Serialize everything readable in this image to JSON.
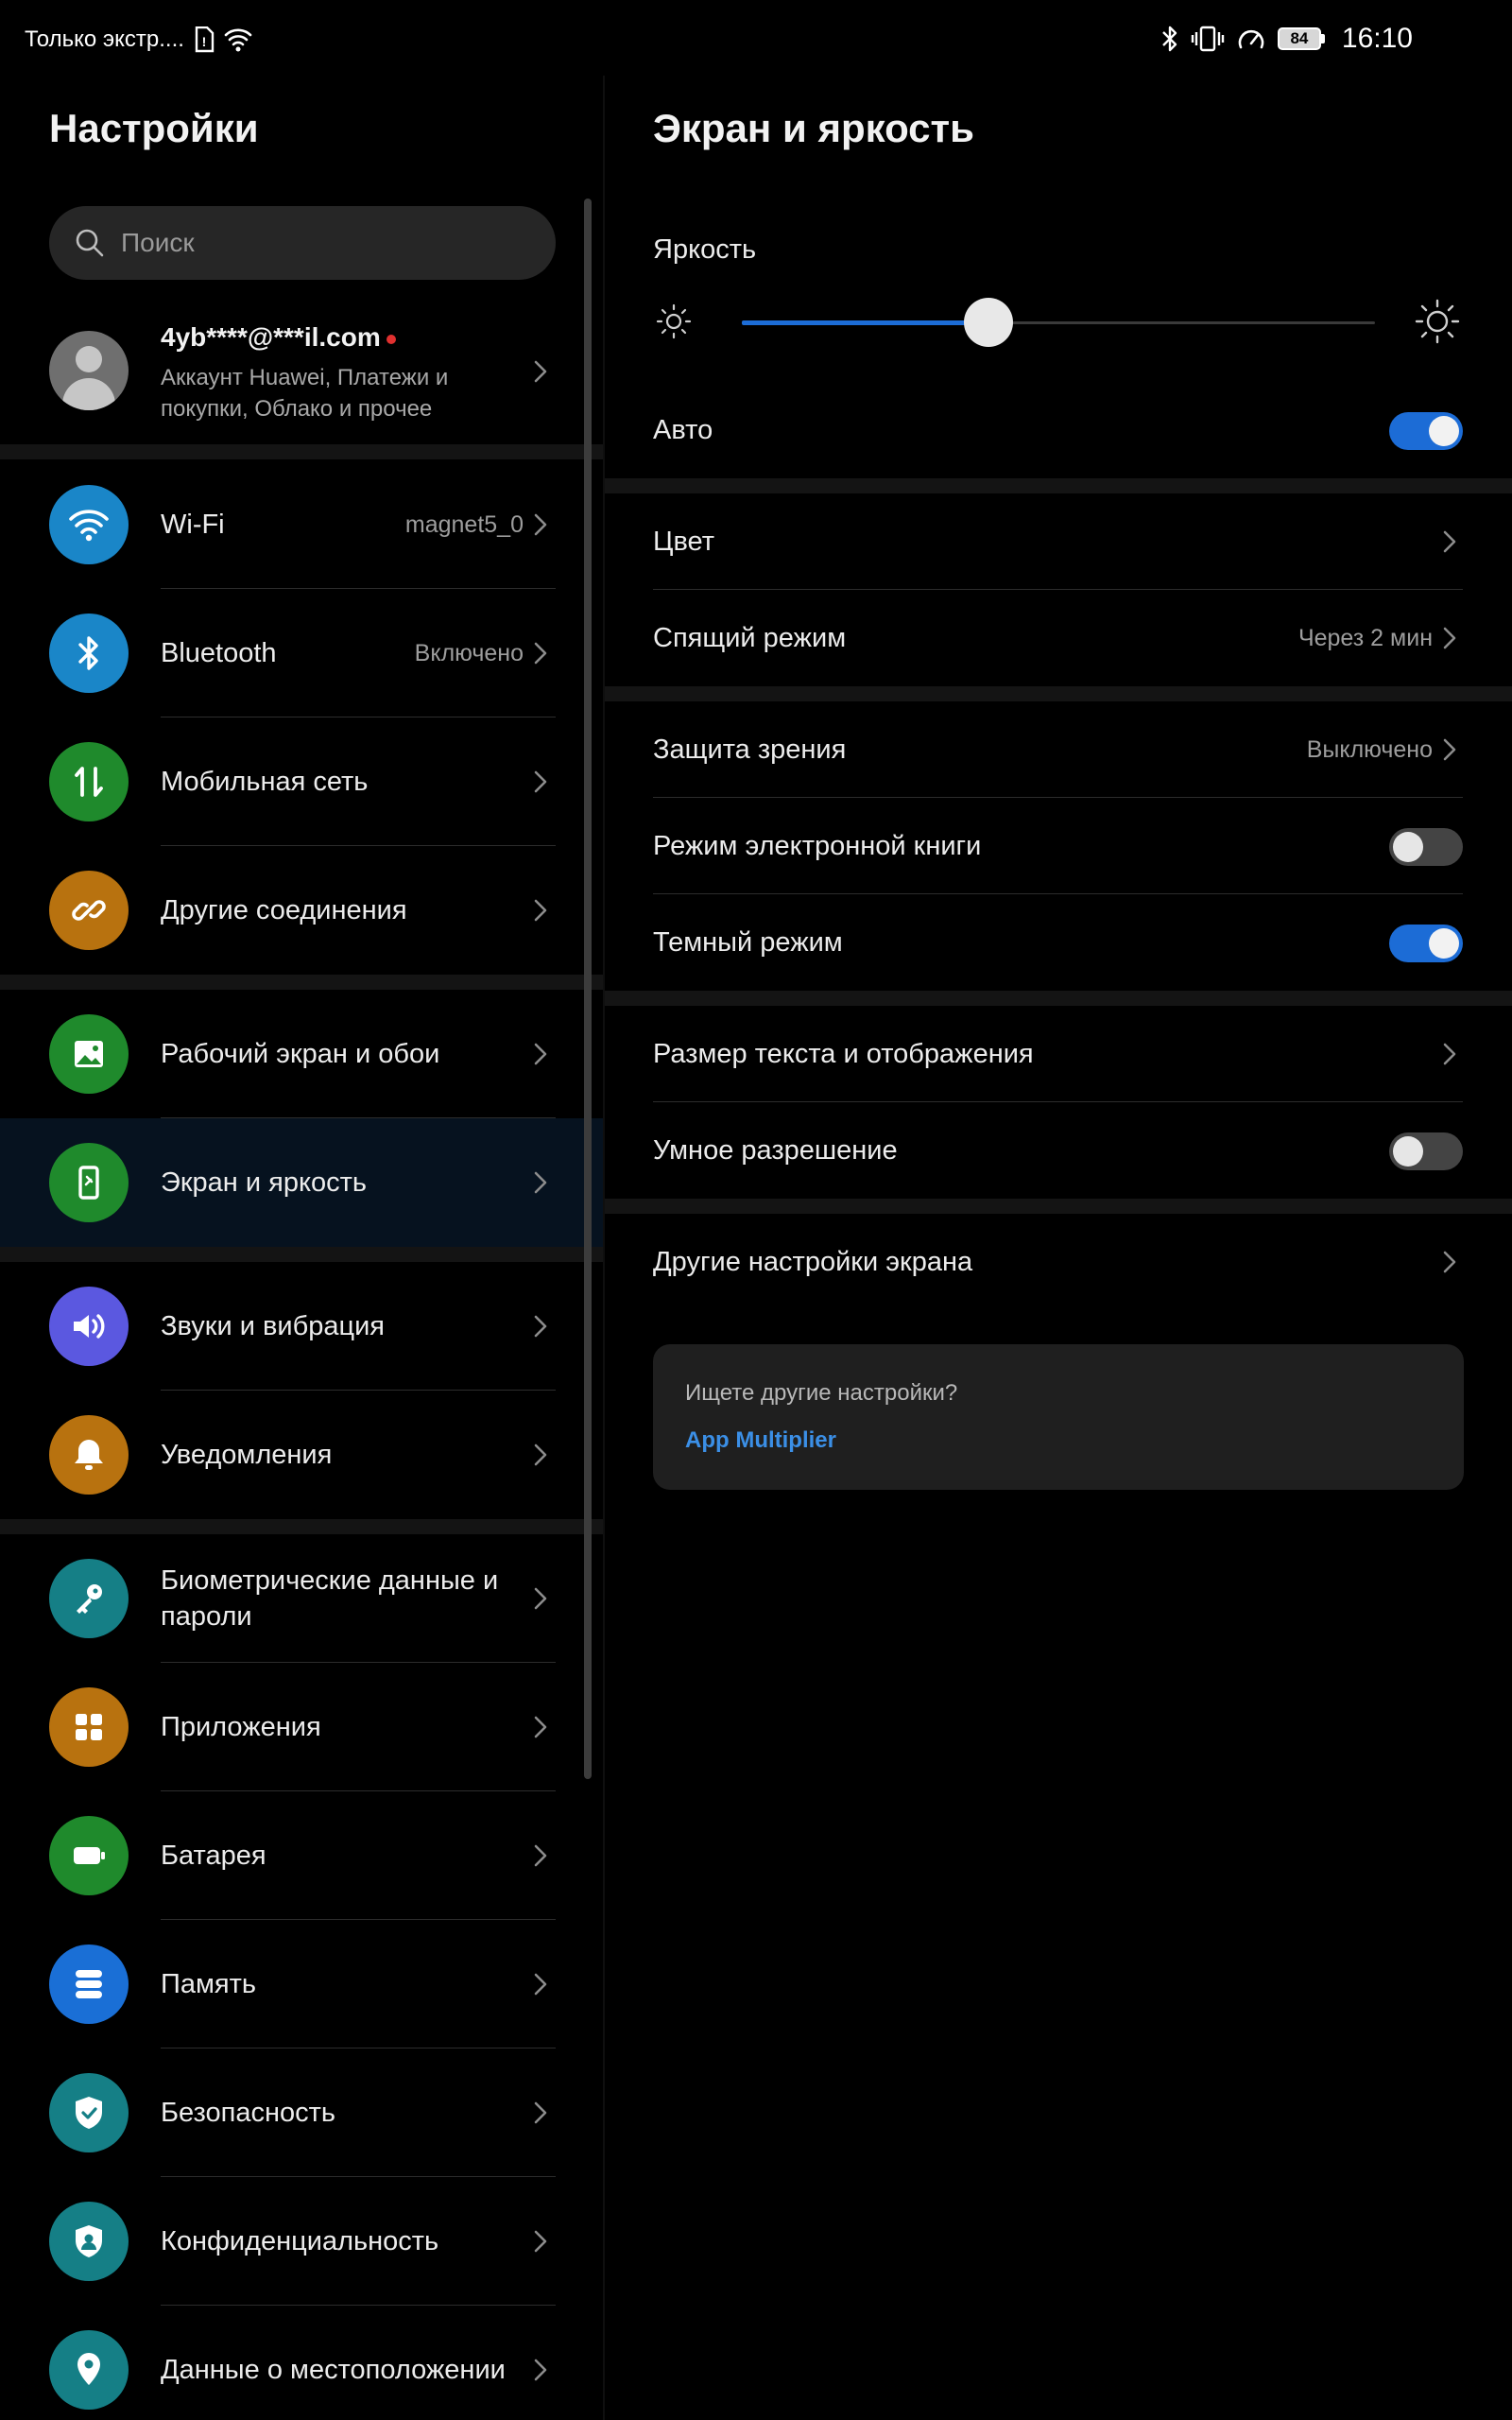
{
  "status_bar": {
    "carrier": "Только экстр....",
    "time": "16:10",
    "battery": "84"
  },
  "left": {
    "title": "Настройки",
    "search_placeholder": "Поиск",
    "account": {
      "email": "4yb****@***il.com",
      "subtitle": "Аккаунт Huawei, Платежи и покупки, Облако и прочее"
    },
    "items": [
      {
        "label": "Wi-Fi",
        "value": "magnet5_0",
        "icon": "wifi-icon",
        "color": "#1a86c8"
      },
      {
        "label": "Bluetooth",
        "value": "Включено",
        "icon": "bluetooth-icon",
        "color": "#1a86c8"
      },
      {
        "label": "Мобильная сеть",
        "value": "",
        "icon": "mobile-network-icon",
        "color": "#1f8a2c"
      },
      {
        "label": "Другие соединения",
        "value": "",
        "icon": "link-icon",
        "color": "#b8720f"
      },
      {
        "label": "Рабочий экран и обои",
        "value": "",
        "icon": "wallpaper-icon",
        "color": "#1f8a2c"
      },
      {
        "label": "Экран и яркость",
        "value": "",
        "icon": "display-icon",
        "color": "#1f8a2c"
      },
      {
        "label": "Звуки и вибрация",
        "value": "",
        "icon": "sound-icon",
        "color": "#5b58e0"
      },
      {
        "label": "Уведомления",
        "value": "",
        "icon": "bell-icon",
        "color": "#b8720f"
      },
      {
        "label": "Биометрические данные и пароли",
        "value": "",
        "icon": "key-icon",
        "color": "#157f86"
      },
      {
        "label": "Приложения",
        "value": "",
        "icon": "apps-icon",
        "color": "#b8720f"
      },
      {
        "label": "Батарея",
        "value": "",
        "icon": "battery-icon",
        "color": "#1f8a2c"
      },
      {
        "label": "Память",
        "value": "",
        "icon": "storage-icon",
        "color": "#1a6fd6"
      },
      {
        "label": "Безопасность",
        "value": "",
        "icon": "shield-icon",
        "color": "#157f86"
      },
      {
        "label": "Конфиденциальность",
        "value": "",
        "icon": "privacy-icon",
        "color": "#157f86"
      },
      {
        "label": "Данные о местоположении",
        "value": "",
        "icon": "location-icon",
        "color": "#157f86"
      }
    ]
  },
  "right": {
    "title": "Экран и яркость",
    "brightness_label": "Яркость",
    "brightness_level": 0.39,
    "auto_label": "Авто",
    "auto_on": true,
    "color_label": "Цвет",
    "sleep_label": "Спящий режим",
    "sleep_value": "Через 2 мин",
    "eye_label": "Защита зрения",
    "eye_value": "Выключено",
    "ebook_label": "Режим электронной книги",
    "ebook_on": false,
    "dark_label": "Темный режим",
    "dark_on": true,
    "text_size_label": "Размер текста и отображения",
    "smart_res_label": "Умное разрешение",
    "smart_res_on": false,
    "other_label": "Другие настройки экрана",
    "card_question": "Ищете другие настройки?",
    "card_link": "App Multiplier"
  },
  "colors": {
    "accent": "#1c6cd6",
    "link": "#3b8fe6",
    "background": "#000000"
  }
}
